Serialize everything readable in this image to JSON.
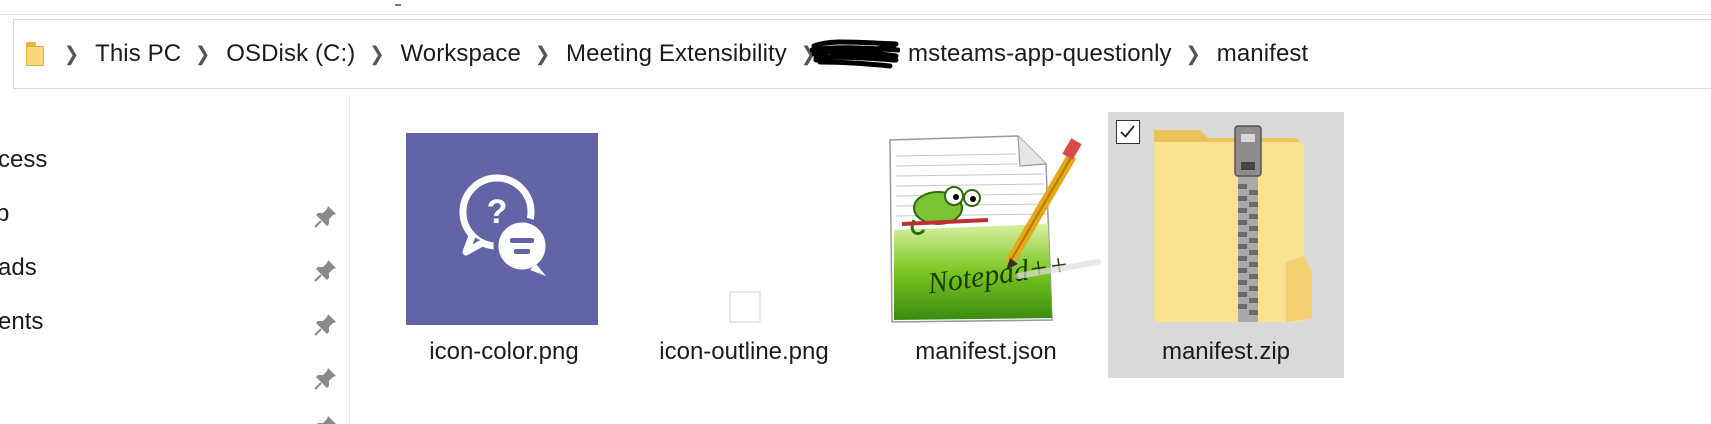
{
  "breadcrumb": {
    "root_icon": "folder-icon",
    "items": [
      {
        "label": "This PC"
      },
      {
        "label": "OSDisk (C:)"
      },
      {
        "label": "Workspace"
      },
      {
        "label": "Meeting Extensibility"
      },
      {
        "label": "msteams-app-questionly"
      },
      {
        "label": "manifest"
      }
    ],
    "separator": "chevron-right-icon"
  },
  "nav": {
    "items": [
      {
        "label": "cess",
        "pinned": false
      },
      {
        "label": "p",
        "pinned": true
      },
      {
        "label": "ads",
        "pinned": true
      },
      {
        "label": "ents",
        "pinned": true
      },
      {
        "label": "",
        "pinned": true
      },
      {
        "label": "",
        "pinned": true
      }
    ]
  },
  "files": [
    {
      "name": "icon-color.png",
      "icon": "teams-question-chat-icon",
      "selected": false
    },
    {
      "name": "icon-outline.png",
      "icon": "blank-image-icon",
      "selected": false
    },
    {
      "name": "manifest.json",
      "icon": "notepad-plus-plus-icon",
      "selected": false
    },
    {
      "name": "manifest.zip",
      "icon": "zip-folder-icon",
      "selected": true
    }
  ],
  "colors": {
    "teams_purple": "#6264a7",
    "folder_yellow": "#f8d775",
    "selection": "#d9d9d9"
  }
}
